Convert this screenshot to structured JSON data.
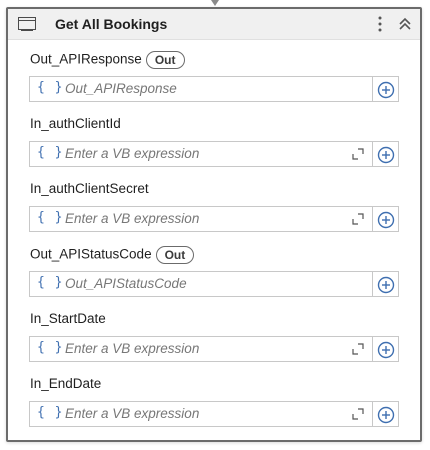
{
  "activity": {
    "title": "Get All Bookings",
    "activity_icon": "window-icon",
    "menu_icon": "kebab-menu-icon",
    "collapse_icon": "double-chevron-up-icon"
  },
  "fields": [
    {
      "label": "Out_APIResponse",
      "direction_badge": "Out",
      "value": "Out_APIResponse",
      "placeholder": "",
      "has_expand": false
    },
    {
      "label": "In_authClientId",
      "direction_badge": "",
      "value": "",
      "placeholder": "Enter a VB expression",
      "has_expand": true
    },
    {
      "label": "In_authClientSecret",
      "direction_badge": "",
      "value": "",
      "placeholder": "Enter a VB expression",
      "has_expand": true
    },
    {
      "label": "Out_APIStatusCode",
      "direction_badge": "Out",
      "value": "Out_APIStatusCode",
      "placeholder": "",
      "has_expand": false
    },
    {
      "label": "In_StartDate",
      "direction_badge": "",
      "value": "",
      "placeholder": "Enter a VB expression",
      "has_expand": true
    },
    {
      "label": "In_EndDate",
      "direction_badge": "",
      "value": "",
      "placeholder": "Enter a VB expression",
      "has_expand": true
    }
  ],
  "icons": {
    "braces": "{ }",
    "add": "plus-circle-icon",
    "expand": "expand-editor-icon"
  },
  "colors": {
    "accent": "#3f6fb0",
    "border": "#6b6b6b",
    "header_bg": "#f0f0f0"
  }
}
